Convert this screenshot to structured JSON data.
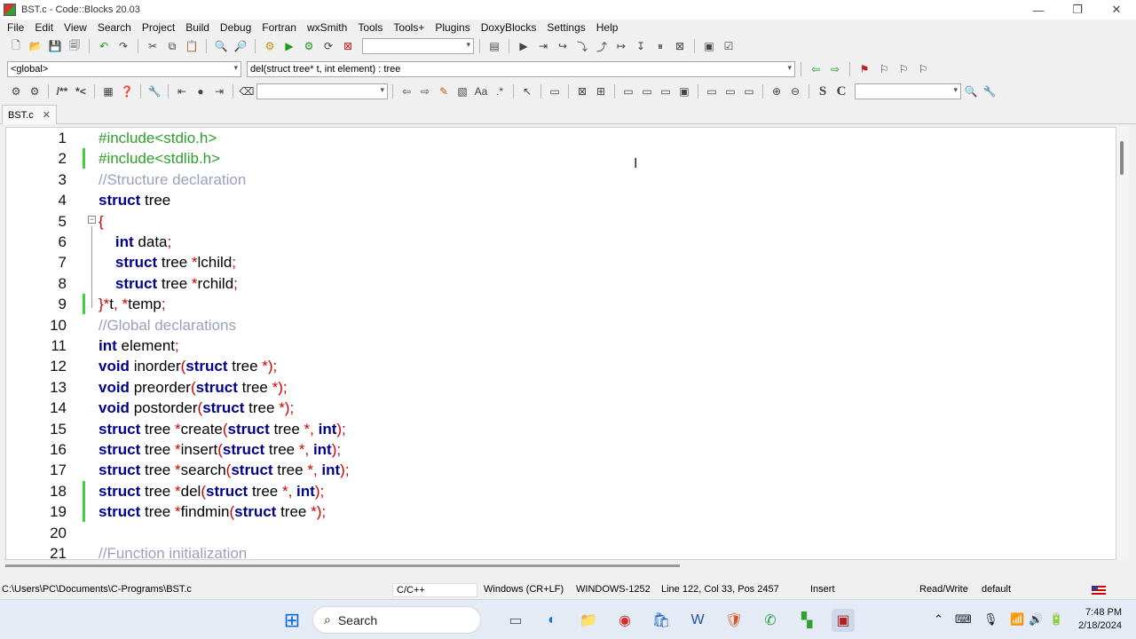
{
  "window": {
    "title": "BST.c - Code::Blocks 20.03",
    "minimize": "—",
    "restore": "❐",
    "close": "✕"
  },
  "menu": [
    "File",
    "Edit",
    "View",
    "Search",
    "Project",
    "Build",
    "Debug",
    "Fortran",
    "wxSmith",
    "Tools",
    "Tools+",
    "Plugins",
    "DoxyBlocks",
    "Settings",
    "Help"
  ],
  "toolbar": {
    "scope_combo": "<global>",
    "function_combo": "del(struct tree* t, int element) : tree",
    "search_combo": "",
    "right_combo": "",
    "bold_s": "S",
    "bold_c": "C"
  },
  "tab": {
    "label": "BST.c",
    "close": "✕"
  },
  "editor": {
    "lines": [
      {
        "n": "1",
        "html": "<span class=\"pp\">#include&lt;stdio.h&gt;</span>"
      },
      {
        "n": "2",
        "html": "<span class=\"pp\">#include&lt;stdlib.h&gt;</span>"
      },
      {
        "n": "3",
        "html": "<span class=\"cm\">//Structure declaration</span>"
      },
      {
        "n": "4",
        "html": "<span class=\"kw\">struct</span> <span class=\"tx\">tree</span>"
      },
      {
        "n": "5",
        "html": "<span class=\"op\">{</span>"
      },
      {
        "n": "6",
        "html": "    <span class=\"kw\">int</span> <span class=\"tx\">data</span><span class=\"op\">;</span>"
      },
      {
        "n": "7",
        "html": "    <span class=\"kw\">struct</span> <span class=\"tx\">tree</span> <span class=\"op\">*</span><span class=\"tx\">lchild</span><span class=\"op\">;</span>"
      },
      {
        "n": "8",
        "html": "    <span class=\"kw\">struct</span> <span class=\"tx\">tree</span> <span class=\"op\">*</span><span class=\"tx\">rchild</span><span class=\"op\">;</span>"
      },
      {
        "n": "9",
        "html": "<span class=\"op\">}*</span><span class=\"tx\">t</span><span class=\"op\">, *</span><span class=\"tx\">temp</span><span class=\"op\">;</span>"
      },
      {
        "n": "10",
        "html": "<span class=\"cm\">//Global declarations</span>"
      },
      {
        "n": "11",
        "html": "<span class=\"kw\">int</span> <span class=\"tx\">element</span><span class=\"op\">;</span>"
      },
      {
        "n": "12",
        "html": "<span class=\"kw\">void</span> <span class=\"tx\">inorder</span><span class=\"op\">(</span><span class=\"kw\">struct</span> <span class=\"tx\">tree</span> <span class=\"op\">*);</span>"
      },
      {
        "n": "13",
        "html": "<span class=\"kw\">void</span> <span class=\"tx\">preorder</span><span class=\"op\">(</span><span class=\"kw\">struct</span> <span class=\"tx\">tree</span> <span class=\"op\">*);</span>"
      },
      {
        "n": "14",
        "html": "<span class=\"kw\">void</span> <span class=\"tx\">postorder</span><span class=\"op\">(</span><span class=\"kw\">struct</span> <span class=\"tx\">tree</span> <span class=\"op\">*);</span>"
      },
      {
        "n": "15",
        "html": "<span class=\"kw\">struct</span> <span class=\"tx\">tree</span> <span class=\"op\">*</span><span class=\"tx\">create</span><span class=\"op\">(</span><span class=\"kw\">struct</span> <span class=\"tx\">tree</span> <span class=\"op\">*, </span><span class=\"kw\">int</span><span class=\"op\">);</span>"
      },
      {
        "n": "16",
        "html": "<span class=\"kw\">struct</span> <span class=\"tx\">tree</span> <span class=\"op\">*</span><span class=\"tx\">insert</span><span class=\"op\">(</span><span class=\"kw\">struct</span> <span class=\"tx\">tree</span> <span class=\"op\">*, </span><span class=\"kw\">int</span><span class=\"op\">);</span>"
      },
      {
        "n": "17",
        "html": "<span class=\"kw\">struct</span> <span class=\"tx\">tree</span> <span class=\"op\">*</span><span class=\"tx\">search</span><span class=\"op\">(</span><span class=\"kw\">struct</span> <span class=\"tx\">tree</span> <span class=\"op\">*, </span><span class=\"kw\">int</span><span class=\"op\">);</span>"
      },
      {
        "n": "18",
        "html": "<span class=\"kw\">struct</span> <span class=\"tx\">tree</span> <span class=\"op\">*</span><span class=\"tx\">del</span><span class=\"op\">(</span><span class=\"kw\">struct</span> <span class=\"tx\">tree</span> <span class=\"op\">*, </span><span class=\"kw\">int</span><span class=\"op\">);</span>"
      },
      {
        "n": "19",
        "html": "<span class=\"kw\">struct</span> <span class=\"tx\">tree</span> <span class=\"op\">*</span><span class=\"tx\">findmin</span><span class=\"op\">(</span><span class=\"kw\">struct</span> <span class=\"tx\">tree</span> <span class=\"op\">*);</span>"
      },
      {
        "n": "20",
        "html": ""
      },
      {
        "n": "21",
        "html": "<span class=\"cm\">//Function initialization</span>"
      }
    ],
    "changed_lines": [
      2,
      9,
      18,
      19
    ]
  },
  "status": {
    "path": "C:\\Users\\PC\\Documents\\C-Programs\\BST.c",
    "language": "C/C++",
    "line_endings": "Windows (CR+LF)",
    "encoding": "WINDOWS-1252",
    "position": "Line 122, Col 33, Pos 2457",
    "mode": "Insert",
    "access": "Read/Write",
    "profile": "default"
  },
  "taskbar": {
    "search_label": "Search",
    "time": "7:48 PM",
    "date": "2/18/2024"
  },
  "colors": {
    "keyword": "#00008b",
    "preprocessor": "#2ca02c",
    "comment": "#9aa0c0",
    "operator": "#cc0000",
    "change_marker": "#40d040"
  }
}
